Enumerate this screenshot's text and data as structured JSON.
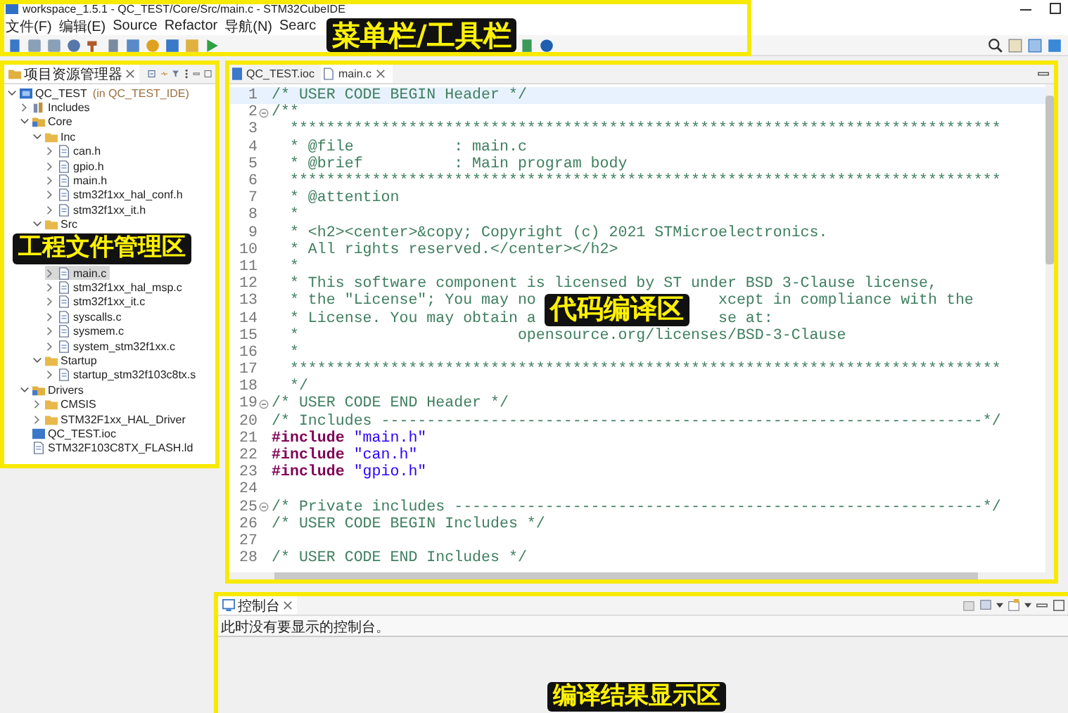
{
  "window": {
    "title": "workspace_1.5.1 - QC_TEST/Core/Src/main.c - STM32CubeIDE"
  },
  "menu_bar": {
    "items": [
      "文件(F)",
      "编辑(E)",
      "Source",
      "Refactor",
      "导航(N)",
      "Searc"
    ],
    "annotation": "菜单栏/工具栏"
  },
  "project_explorer": {
    "tab": "项目资源管理器",
    "annotation": "工程文件管理区",
    "tree": [
      {
        "label": "QC_TEST",
        "suffix": "(in QC_TEST_IDE)",
        "kind": "project",
        "expanded": true,
        "selected": false,
        "children": [
          {
            "label": "Includes",
            "kind": "library",
            "expanded": false,
            "selected": false
          },
          {
            "label": "Core",
            "kind": "source-folder",
            "expanded": true,
            "selected": false,
            "children": [
              {
                "label": "Inc",
                "kind": "folder",
                "expanded": true,
                "selected": false,
                "children": [
                  {
                    "label": "can.h",
                    "kind": "file",
                    "expanded": false,
                    "selected": false
                  },
                  {
                    "label": "gpio.h",
                    "kind": "file",
                    "expanded": false,
                    "selected": false
                  },
                  {
                    "label": "main.h",
                    "kind": "file",
                    "expanded": false,
                    "selected": false
                  },
                  {
                    "label": "stm32f1xx_hal_conf.h",
                    "kind": "file",
                    "expanded": false,
                    "selected": false
                  },
                  {
                    "label": "stm32f1xx_it.h",
                    "kind": "file",
                    "expanded": false,
                    "selected": false
                  }
                ]
              },
              {
                "label": "Src",
                "kind": "folder",
                "expanded": true,
                "selected": false,
                "children": [
                  {
                    "kind": "covered"
                  },
                  {
                    "label": "main.c",
                    "kind": "file",
                    "expanded": false,
                    "selected": true
                  },
                  {
                    "label": "stm32f1xx_hal_msp.c",
                    "kind": "file",
                    "expanded": false,
                    "selected": false
                  },
                  {
                    "label": "stm32f1xx_it.c",
                    "kind": "file",
                    "expanded": false,
                    "selected": false
                  },
                  {
                    "label": "syscalls.c",
                    "kind": "file",
                    "expanded": false,
                    "selected": false
                  },
                  {
                    "label": "sysmem.c",
                    "kind": "file",
                    "expanded": false,
                    "selected": false
                  },
                  {
                    "label": "system_stm32f1xx.c",
                    "kind": "file",
                    "expanded": false,
                    "selected": false
                  }
                ]
              },
              {
                "label": "Startup",
                "kind": "folder",
                "expanded": true,
                "selected": false,
                "children": [
                  {
                    "label": "startup_stm32f103c8tx.s",
                    "kind": "file",
                    "expanded": false,
                    "selected": false
                  }
                ]
              }
            ]
          },
          {
            "label": "Drivers",
            "kind": "source-folder",
            "expanded": true,
            "selected": false,
            "children": [
              {
                "label": "CMSIS",
                "kind": "folder",
                "expanded": false,
                "selected": false
              },
              {
                "label": "STM32F1xx_HAL_Driver",
                "kind": "folder",
                "expanded": false,
                "selected": false
              }
            ]
          },
          {
            "label": "QC_TEST.ioc",
            "kind": "ioc",
            "selected": false
          },
          {
            "label": "STM32F103C8TX_FLASH.ld",
            "kind": "file",
            "selected": false
          }
        ]
      }
    ]
  },
  "editor": {
    "tabs": [
      {
        "label": "QC_TEST.ioc",
        "kind": "ioc",
        "selected": false
      },
      {
        "label": "main.c",
        "kind": "file",
        "selected": true
      }
    ],
    "annotation": "代码编译区",
    "lines": [
      {
        "n": "1",
        "kind": "comment",
        "text": "/* USER CODE BEGIN Header */",
        "fold": false,
        "current": true
      },
      {
        "n": "2",
        "kind": "comment",
        "text": "/**",
        "fold": true,
        "current": false
      },
      {
        "n": "3",
        "kind": "comment",
        "text": "  ******************************************************************************",
        "fold": false,
        "current": false
      },
      {
        "n": "4",
        "kind": "comment",
        "text": "  * @file           : main.c",
        "fold": false,
        "current": false
      },
      {
        "n": "5",
        "kind": "comment",
        "text": "  * @brief          : Main program body",
        "fold": false,
        "current": false
      },
      {
        "n": "6",
        "kind": "comment",
        "text": "  ******************************************************************************",
        "fold": false,
        "current": false
      },
      {
        "n": "7",
        "kind": "comment",
        "text": "  * @attention",
        "fold": false,
        "current": false
      },
      {
        "n": "8",
        "kind": "comment",
        "text": "  *",
        "fold": false,
        "current": false
      },
      {
        "n": "9",
        "kind": "comment",
        "text": "  * <h2><center>&copy; Copyright (c) 2021 STMicroelectronics.",
        "fold": false,
        "current": false
      },
      {
        "n": "10",
        "kind": "comment",
        "text": "  * All rights reserved.</center></h2>",
        "fold": false,
        "current": false
      },
      {
        "n": "11",
        "kind": "comment",
        "text": "  *",
        "fold": false,
        "current": false
      },
      {
        "n": "12",
        "kind": "comment",
        "text": "  * This software component is licensed by ST under BSD 3-Clause license,",
        "fold": false,
        "current": false
      },
      {
        "n": "13",
        "kind": "comment",
        "text": "  * the \"License\"; You may no",
        "text_after": "xcept in compliance with the",
        "fold": false,
        "current": false
      },
      {
        "n": "14",
        "kind": "comment",
        "text": "  * License. You may obtain a",
        "text_after": "se at:",
        "fold": false,
        "current": false
      },
      {
        "n": "15",
        "kind": "comment",
        "text": "  *                        opensource.org/licenses/BSD-3-Clause",
        "fold": false,
        "current": false
      },
      {
        "n": "16",
        "kind": "comment",
        "text": "  *",
        "fold": false,
        "current": false
      },
      {
        "n": "17",
        "kind": "comment",
        "text": "  ******************************************************************************",
        "fold": false,
        "current": false
      },
      {
        "n": "18",
        "kind": "comment",
        "text": "  */",
        "fold": false,
        "current": false
      },
      {
        "n": "19",
        "kind": "comment",
        "text": "/* USER CODE END Header */",
        "fold": true,
        "current": false
      },
      {
        "n": "20",
        "kind": "comment",
        "text": "/* Includes ------------------------------------------------------------------*/",
        "fold": false,
        "current": false
      },
      {
        "n": "21",
        "kind": "include",
        "keyword": "#include",
        "text": "\"main.h\"",
        "fold": false,
        "current": false
      },
      {
        "n": "22",
        "kind": "include",
        "keyword": "#include",
        "text": "\"can.h\"",
        "fold": false,
        "current": false
      },
      {
        "n": "23",
        "kind": "include",
        "keyword": "#include",
        "text": "\"gpio.h\"",
        "fold": false,
        "current": false
      },
      {
        "n": "24",
        "kind": "blank",
        "fold": false,
        "current": false
      },
      {
        "n": "25",
        "kind": "comment",
        "text": "/* Private includes ----------------------------------------------------------*/",
        "fold": true,
        "current": false
      },
      {
        "n": "26",
        "kind": "comment",
        "text": "/* USER CODE BEGIN Includes */",
        "fold": false,
        "current": false
      },
      {
        "n": "27",
        "kind": "blank",
        "fold": false,
        "current": false
      },
      {
        "n": "28",
        "kind": "comment",
        "text": "/* USER CODE END Includes */",
        "fold": false,
        "current": false
      }
    ]
  },
  "console": {
    "tab": "控制台",
    "message": "此时没有要显示的控制台。",
    "annotation": "编译结果显示区"
  }
}
